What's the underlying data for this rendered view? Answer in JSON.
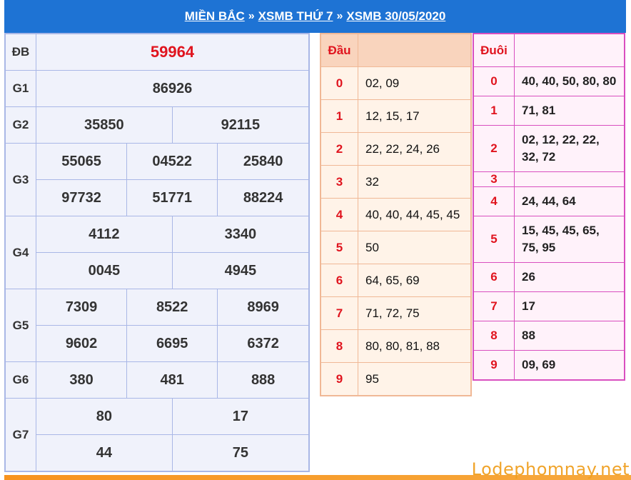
{
  "header": {
    "link1": "MIỀN BẮC",
    "link2": "XSMB THỨ 7",
    "link3": "XSMB 30/05/2020",
    "separator": "»"
  },
  "results": {
    "db": {
      "label": "ĐB",
      "value": "59964"
    },
    "g1": {
      "label": "G1",
      "values": [
        "86926"
      ]
    },
    "g2": {
      "label": "G2",
      "values": [
        "35850",
        "92115"
      ]
    },
    "g3": {
      "label": "G3",
      "values": [
        "55065",
        "04522",
        "25840",
        "97732",
        "51771",
        "88224"
      ]
    },
    "g4": {
      "label": "G4",
      "values": [
        "4112",
        "3340",
        "0045",
        "4945"
      ]
    },
    "g5": {
      "label": "G5",
      "values": [
        "7309",
        "8522",
        "8969",
        "9602",
        "6695",
        "6372"
      ]
    },
    "g6": {
      "label": "G6",
      "values": [
        "380",
        "481",
        "888"
      ]
    },
    "g7": {
      "label": "G7",
      "values": [
        "80",
        "17",
        "44",
        "75"
      ]
    }
  },
  "dau": {
    "header": "Đầu",
    "rows": [
      {
        "k": "0",
        "v": "02, 09"
      },
      {
        "k": "1",
        "v": "12, 15, 17"
      },
      {
        "k": "2",
        "v": "22, 22, 24, 26"
      },
      {
        "k": "3",
        "v": "32"
      },
      {
        "k": "4",
        "v": "40, 40, 44, 45, 45"
      },
      {
        "k": "5",
        "v": "50"
      },
      {
        "k": "6",
        "v": "64, 65, 69"
      },
      {
        "k": "7",
        "v": "71, 72, 75"
      },
      {
        "k": "8",
        "v": "80, 80, 81, 88"
      },
      {
        "k": "9",
        "v": "95"
      }
    ]
  },
  "duoi": {
    "header": "Đuôi",
    "rows": [
      {
        "k": "0",
        "v": "40, 40, 50, 80, 80"
      },
      {
        "k": "1",
        "v": "71, 81"
      },
      {
        "k": "2",
        "v": "02, 12, 22, 22, 32, 72"
      },
      {
        "k": "3",
        "v": ""
      },
      {
        "k": "4",
        "v": "24, 44, 64"
      },
      {
        "k": "5",
        "v": "15, 45, 45, 65, 75, 95"
      },
      {
        "k": "6",
        "v": "26"
      },
      {
        "k": "7",
        "v": "17"
      },
      {
        "k": "8",
        "v": "88"
      },
      {
        "k": "9",
        "v": "09, 69"
      }
    ]
  },
  "watermark": "Lodephomnay.net",
  "colors": {
    "header_bg": "#1e73d4",
    "special_prize": "#e0141e",
    "results_border": "#a9b7e6",
    "dau_border": "#f0b896",
    "duoi_border": "#d94fbf",
    "watermark": "#f0a020"
  }
}
